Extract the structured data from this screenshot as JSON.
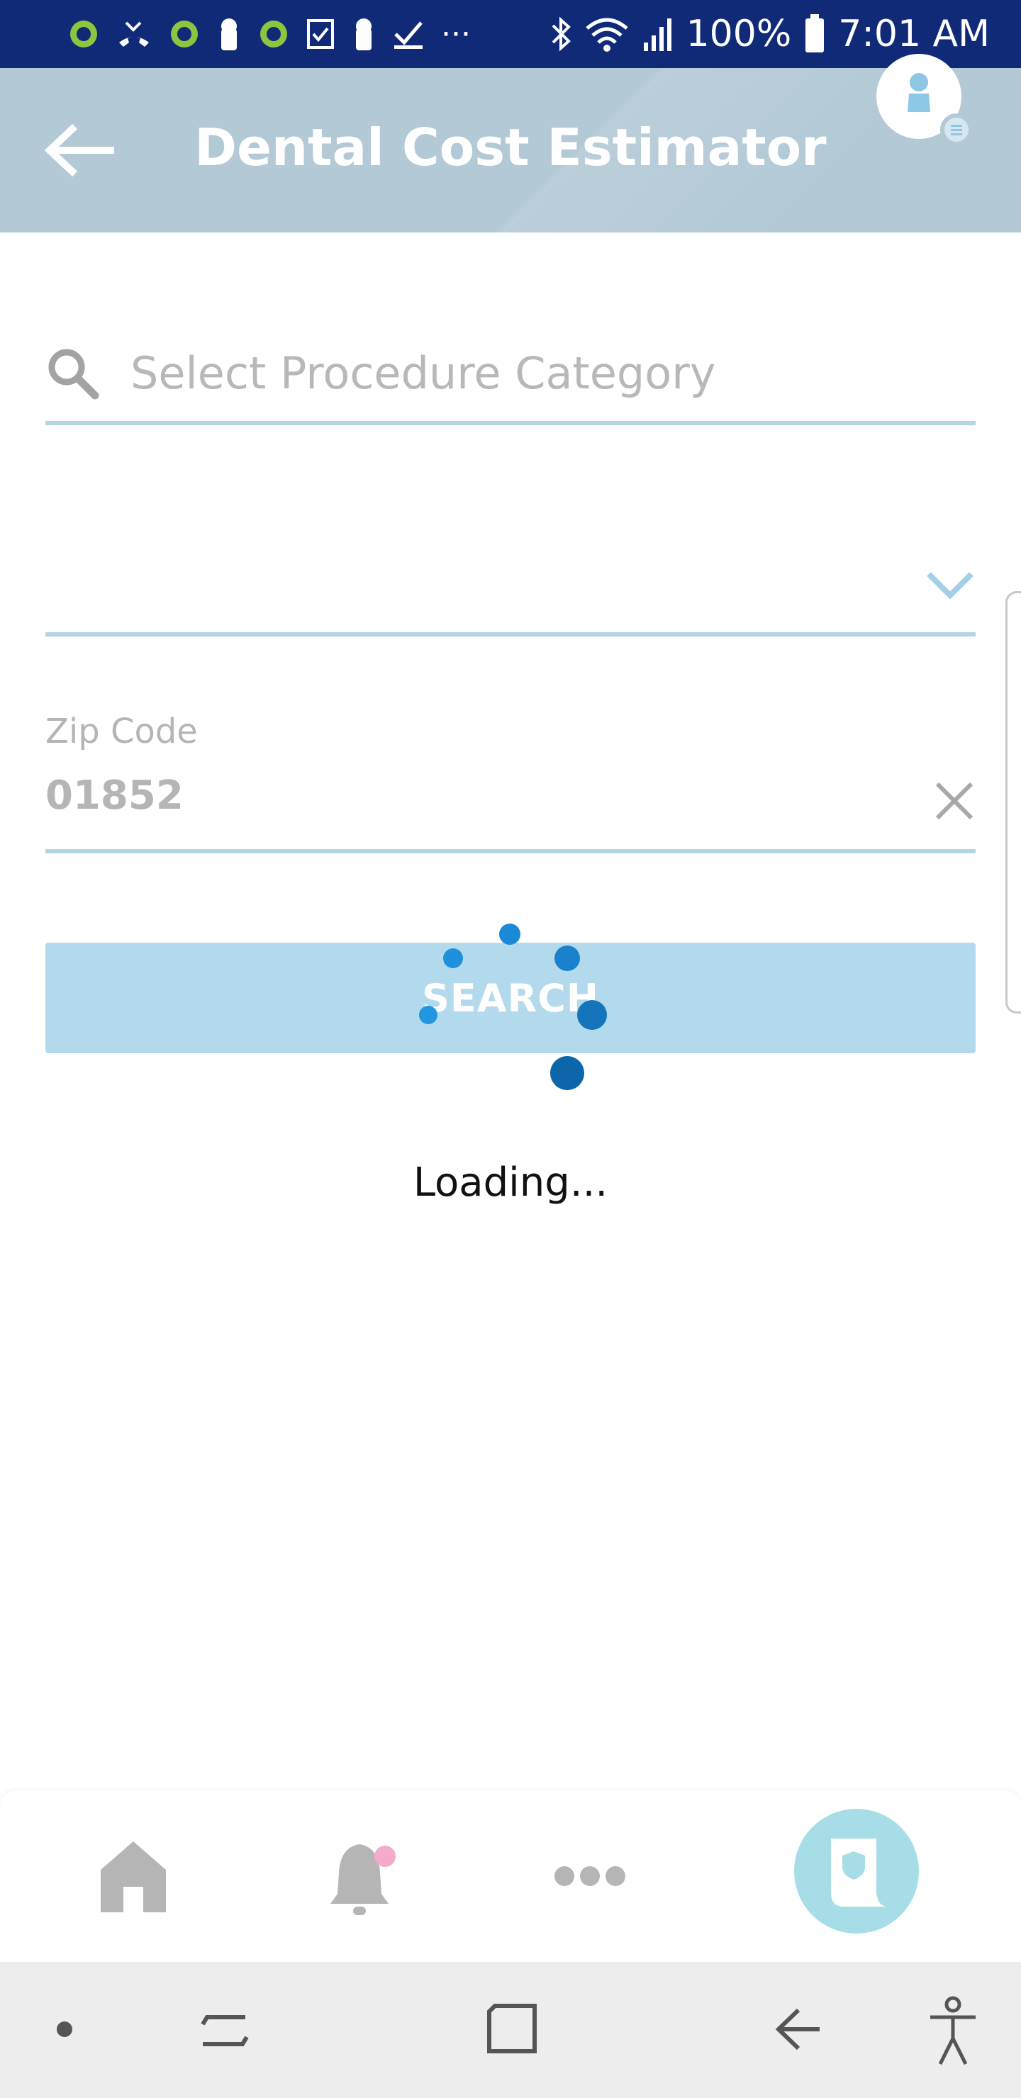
{
  "status_bar": {
    "icons": [
      "lime-app-icon",
      "missed-call-icon",
      "lime-app-icon",
      "keyhole-icon",
      "lime-app-icon",
      "checkbox-icon",
      "keyhole-icon",
      "check-icon",
      "more-dots-icon",
      "bluetooth-icon",
      "wifi-icon",
      "signal-icon",
      "battery-icon"
    ],
    "overflow": "···",
    "battery": "100%",
    "time": "7:01 AM"
  },
  "app_bar": {
    "title": "Dental Cost Estimator",
    "back_icon": "back-arrow-icon",
    "profile_icon": "profile-icon"
  },
  "form": {
    "procedure_search": {
      "placeholder": "Select Procedure Category",
      "icon": "search-icon"
    },
    "procedure_dropdown": {
      "value": "",
      "icon": "chevron-down-icon"
    },
    "zip": {
      "label": "Zip Code",
      "value": "01852",
      "clear_icon": "close-icon"
    },
    "search_button": {
      "label": "SEARCH"
    }
  },
  "loading": {
    "text": "Loading..."
  },
  "tab_bar": {
    "items": [
      {
        "name": "home",
        "icon": "home-icon"
      },
      {
        "name": "notifications",
        "icon": "bell-icon",
        "has_badge": true
      },
      {
        "name": "more",
        "icon": "more-icon"
      },
      {
        "name": "coverage",
        "icon": "shield-document-icon",
        "active": true
      }
    ]
  },
  "nav_bar": {
    "icons": [
      "dot-icon",
      "recent-apps-icon",
      "home-square-icon",
      "back-icon",
      "accessibility-icon"
    ]
  },
  "colors": {
    "status_bar": "#112a78",
    "app_bar": "#b3c9d6",
    "accent": "#0a86d4",
    "underline": "#b3d4e4",
    "button": "#b3d9ec",
    "active_tab": "#a6dde6",
    "badge": "#f4aacb"
  }
}
